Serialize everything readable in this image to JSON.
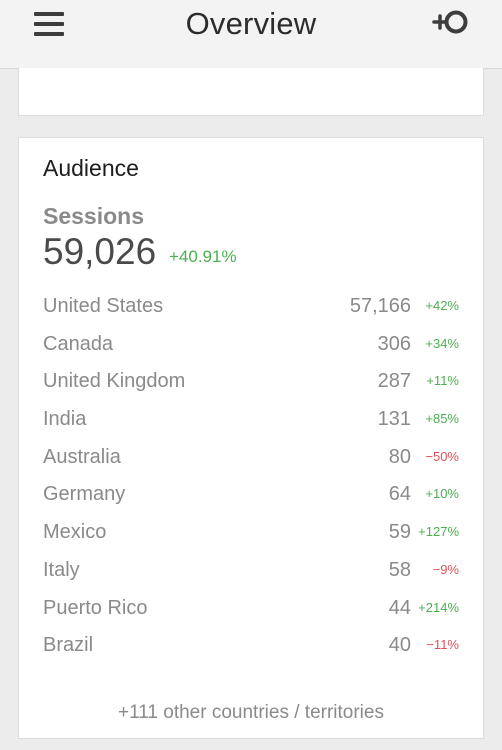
{
  "header": {
    "title": "Overview",
    "menu_icon": "hamburger-menu-icon",
    "add_icon": "add-circle-icon"
  },
  "audience": {
    "title": "Audience",
    "metric_label": "Sessions",
    "metric_value": "59,026",
    "metric_change": "+40.91%",
    "rows": [
      {
        "country": "United States",
        "count": "57,166",
        "change": "+42%",
        "trend": "up"
      },
      {
        "country": "Canada",
        "count": "306",
        "change": "+34%",
        "trend": "up"
      },
      {
        "country": "United Kingdom",
        "count": "287",
        "change": "+11%",
        "trend": "up"
      },
      {
        "country": "India",
        "count": "131",
        "change": "+85%",
        "trend": "up"
      },
      {
        "country": "Australia",
        "count": "80",
        "change": "−50%",
        "trend": "down"
      },
      {
        "country": "Germany",
        "count": "64",
        "change": "+10%",
        "trend": "up"
      },
      {
        "country": "Mexico",
        "count": "59",
        "change": "+127%",
        "trend": "up"
      },
      {
        "country": "Italy",
        "count": "58",
        "change": "−9%",
        "trend": "down"
      },
      {
        "country": "Puerto Rico",
        "count": "44",
        "change": "+214%",
        "trend": "up"
      },
      {
        "country": "Brazil",
        "count": "40",
        "change": "−11%",
        "trend": "down"
      }
    ],
    "more_link": "+111 other countries / territories"
  },
  "colors": {
    "positive": "#4caf50",
    "negative": "#e0505a",
    "text_muted": "#8a8a8a",
    "background": "#ececec"
  }
}
